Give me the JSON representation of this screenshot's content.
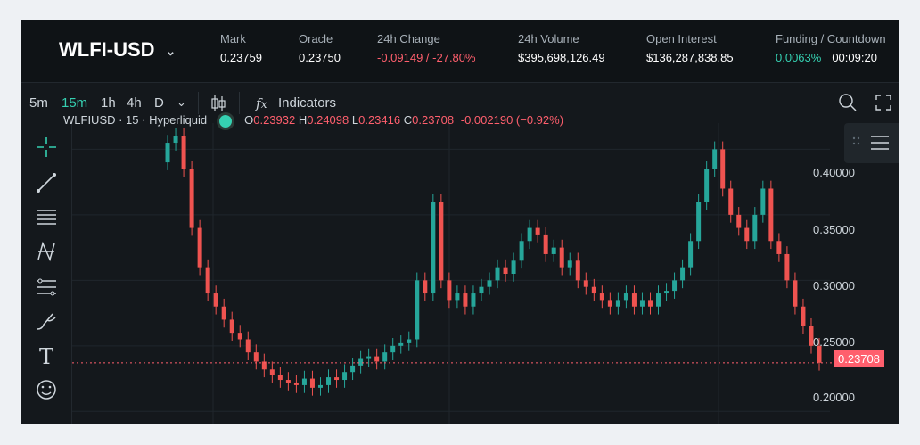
{
  "header": {
    "pair": "WLFI-USD",
    "stats": [
      {
        "label": "Mark",
        "value": "0.23759",
        "underline": true
      },
      {
        "label": "Oracle",
        "value": "0.23750",
        "underline": true
      },
      {
        "label": "24h Change",
        "value": "-0.09149 / -27.80%",
        "underline": false,
        "tone": "neg"
      },
      {
        "label": "24h Volume",
        "value": "$395,698,126.49",
        "underline": false
      },
      {
        "label": "Open Interest",
        "value": "$136,287,838.85",
        "underline": true
      },
      {
        "label": "Funding / Countdown",
        "value": "0.0063%",
        "value2": "00:09:20",
        "underline": true
      }
    ]
  },
  "toolbar": {
    "intervals": [
      "5m",
      "15m",
      "1h",
      "4h",
      "D"
    ],
    "active_interval": "15m",
    "indicators_label": "Indicators"
  },
  "legend": {
    "symbol": "WLFIUSD · 15 · Hyperliquid",
    "o_label": "O",
    "o": "0.23932",
    "h_label": "H",
    "h": "0.24098",
    "l_label": "L",
    "l": "0.23416",
    "c_label": "C",
    "c": "0.23708",
    "change": "-0.002190 (−0.92%)"
  },
  "chart_data": {
    "type": "line",
    "x": [
      0,
      1,
      2,
      3,
      4,
      5,
      6,
      7,
      8,
      9,
      10,
      11,
      12,
      13,
      14,
      15,
      16,
      17,
      18,
      19,
      20,
      21,
      22,
      23,
      24,
      25,
      26,
      27,
      28,
      29,
      30,
      31,
      32,
      33,
      34,
      35,
      36,
      37,
      38,
      39,
      40,
      41,
      42,
      43,
      44,
      45,
      46,
      47,
      48,
      49,
      50,
      51,
      52,
      53,
      54,
      55,
      56,
      57,
      58,
      59,
      60,
      61,
      62,
      63,
      64,
      65,
      66,
      67,
      68,
      69,
      70,
      71,
      72,
      73,
      74,
      75,
      76,
      77,
      78,
      79,
      80,
      81,
      82,
      83,
      84,
      85,
      86,
      87,
      88,
      89,
      90,
      91,
      92,
      93,
      94,
      95,
      96,
      97,
      98,
      99
    ],
    "y": [
      0.39,
      0.405,
      0.41,
      0.385,
      0.34,
      0.31,
      0.29,
      0.28,
      0.27,
      0.26,
      0.255,
      0.245,
      0.238,
      0.232,
      0.228,
      0.224,
      0.222,
      0.22,
      0.225,
      0.218,
      0.22,
      0.226,
      0.224,
      0.23,
      0.235,
      0.24,
      0.242,
      0.238,
      0.245,
      0.25,
      0.252,
      0.255,
      0.3,
      0.29,
      0.36,
      0.3,
      0.285,
      0.29,
      0.28,
      0.29,
      0.295,
      0.3,
      0.31,
      0.305,
      0.315,
      0.33,
      0.34,
      0.335,
      0.32,
      0.325,
      0.31,
      0.315,
      0.3,
      0.295,
      0.29,
      0.285,
      0.28,
      0.285,
      0.29,
      0.28,
      0.285,
      0.28,
      0.29,
      0.292,
      0.3,
      0.31,
      0.33,
      0.36,
      0.385,
      0.4,
      0.37,
      0.35,
      0.34,
      0.33,
      0.35,
      0.37,
      0.33,
      0.32,
      0.3,
      0.28,
      0.265,
      0.25,
      0.2371
    ],
    "ylim": [
      0.19,
      0.42
    ],
    "yticks": [
      "0.40000",
      "0.35000",
      "0.30000",
      "0.25000",
      "0.20000"
    ],
    "last_price": "0.23708",
    "colors": {
      "up": "#26a69a",
      "down": "#ef5350",
      "grid": "#1f262c"
    }
  }
}
